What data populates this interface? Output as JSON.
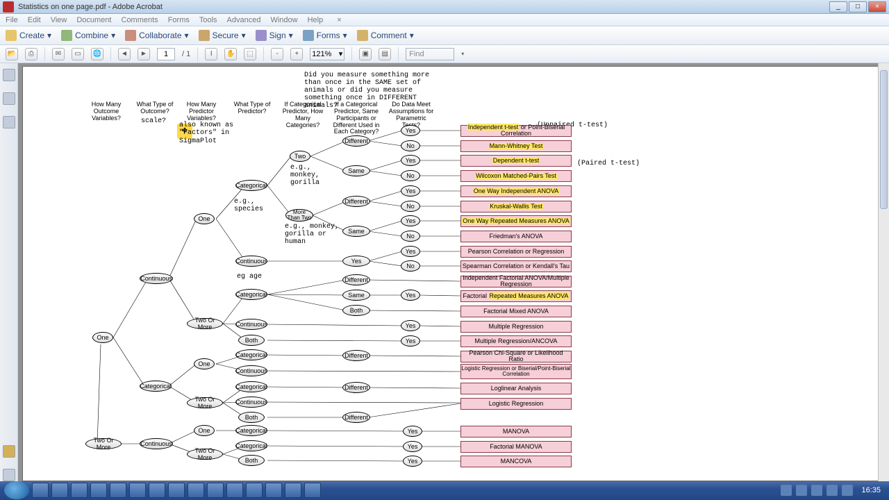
{
  "window": {
    "title": "Statistics on one page.pdf - Adobe Acrobat",
    "close_x": "×"
  },
  "menu": {
    "file": "File",
    "edit": "Edit",
    "view": "View",
    "document": "Document",
    "comments": "Comments",
    "forms": "Forms",
    "tools": "Tools",
    "advanced": "Advanced",
    "window": "Window",
    "help": "Help"
  },
  "toolbar1": {
    "create": "Create",
    "combine": "Combine",
    "collaborate": "Collaborate",
    "secure": "Secure",
    "sign": "Sign",
    "forms": "Forms",
    "comment": "Comment"
  },
  "toolbar2": {
    "page": "1",
    "pages": "/ 1",
    "zoom": "121%",
    "find": "Find"
  },
  "diagram": {
    "top_note": "Did you measure something more than once in the SAME set of animals or did you measure something once in DIFFERENT animals?",
    "headers": {
      "h1": "How Many Outcome Variables?",
      "h2": "What Type of Outcome?",
      "h3": "How Many Predictor Variables?",
      "h4": "What Type of Predictor?",
      "h5": "If Categorical Predictor, How Many Categories?",
      "h6": "If a Categorical Predictor, Same Participants or Different Used in Each Category?",
      "h7": "Do Data Meet Assumptions for Parametric Tests?"
    },
    "labels": {
      "scale": "scale?",
      "factors": "also known as \"Factors\" in SigmaPlot",
      "species": "e.g., species",
      "two_eg": "e.g., monkey, gorilla",
      "mt2_eg": "e.g., monkey, gorilla or human",
      "age": "eg age",
      "unpaired": "(Unpaired t-test)",
      "paired": "(Paired t-test)"
    },
    "nodes": {
      "one_a": "One",
      "two_or_more_a": "Two Or More",
      "continuous_a": "Continuous",
      "categorical_b": "Categorical",
      "continuous_b": "Continuous",
      "one_b": "One",
      "two_or_more_b": "Two Or More",
      "one_c": "One",
      "two_or_more_c": "Two Or More",
      "one_d": "One",
      "two_or_more_d": "Two Or More",
      "categorical": "Categorical",
      "continuous": "Continuous",
      "both": "Both",
      "two": "Two",
      "more_than_two": "More Than Two",
      "different": "Different",
      "same": "Same",
      "yes": "Yes",
      "no": "No"
    },
    "results": {
      "r1a": "Independent t-test",
      "r1b": " or Point-Biserial Correlation",
      "r2": "Mann-Whitney Test",
      "r3": "Dependent t-test",
      "r4": "Wilcoxon Matched-Pairs Test",
      "r5": "One Way Independent ANOVA",
      "r6": "Kruskal-Wallis Test",
      "r7": "One Way Repeated Measures ANOVA",
      "r8": "Friedman's ANOVA",
      "r9": "Pearson Correlation or Regression",
      "r10": "Spearman Correlation or Kendall's Tau",
      "r11": "Independent Factorial ANOVA/Multiple Regression",
      "r12a": "Factorial ",
      "r12b": "Repeated Measures ANOVA",
      "r13": "Factorial Mixed ANOVA",
      "r14": "Multiple Regression",
      "r15": "Multiple Regression/ANCOVA",
      "r16": "Pearson Chi-Square or Likelihood Ratio",
      "r17": "Logistic Regression or Biserial/Point-Biserial Correlation",
      "r18": "Loglinear Analysis",
      "r19": "Logistic Regression",
      "r20": "MANOVA",
      "r21": "Factorial MANOVA",
      "r22": "MANCOVA"
    }
  },
  "taskbar": {
    "time": "16:35"
  }
}
